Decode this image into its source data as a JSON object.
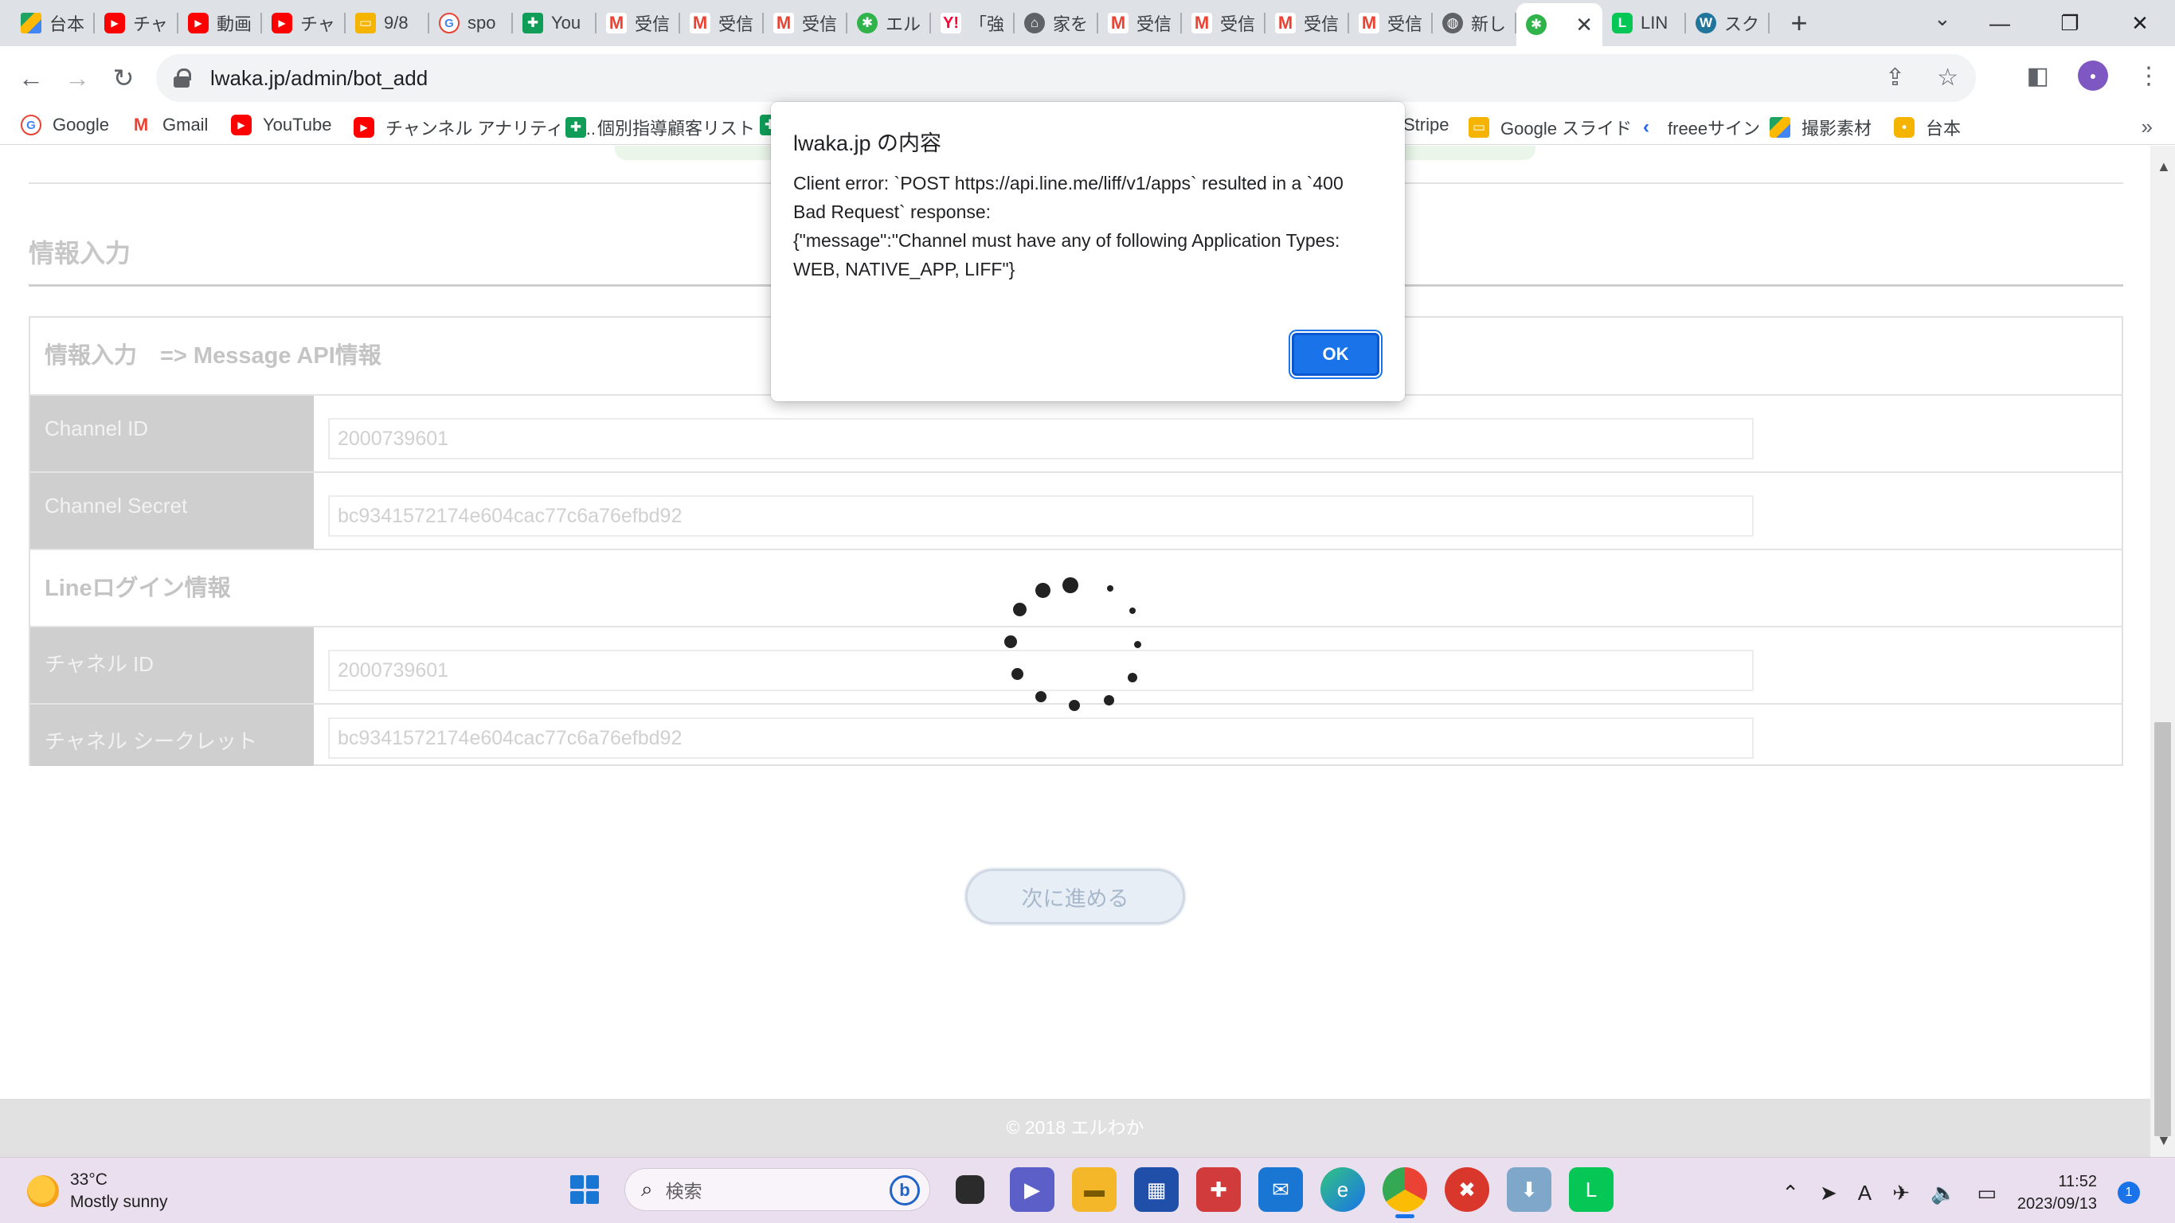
{
  "tabs": [
    {
      "label": "台本",
      "icon": "google-drive-icon"
    },
    {
      "label": "チャ",
      "icon": "youtube-icon"
    },
    {
      "label": "動画",
      "icon": "youtube-icon"
    },
    {
      "label": "チャ",
      "icon": "youtube-icon"
    },
    {
      "label": "9/8",
      "icon": "google-slides-icon"
    },
    {
      "label": "spo",
      "icon": "google-icon"
    },
    {
      "label": "You",
      "icon": "google-sheets-icon"
    },
    {
      "label": "受信",
      "icon": "gmail-icon"
    },
    {
      "label": "受信",
      "icon": "gmail-icon"
    },
    {
      "label": "受信",
      "icon": "gmail-icon"
    },
    {
      "label": "エル",
      "icon": "bug-icon"
    },
    {
      "label": "「強",
      "icon": "yahoo-icon"
    },
    {
      "label": "家を",
      "icon": "house-icon"
    },
    {
      "label": "受信",
      "icon": "gmail-icon"
    },
    {
      "label": "受信",
      "icon": "gmail-icon"
    },
    {
      "label": "受信",
      "icon": "gmail-icon"
    },
    {
      "label": "受信",
      "icon": "gmail-icon"
    },
    {
      "label": "新し",
      "icon": "globe-icon"
    },
    {
      "label": "",
      "icon": "bug-icon",
      "active": true
    },
    {
      "label": "LIN",
      "icon": "line-icon"
    },
    {
      "label": "スク",
      "icon": "wordpress-icon"
    }
  ],
  "address": {
    "url": "lwaka.jp/admin/bot_add"
  },
  "bookmarks": [
    {
      "label": "Google",
      "icon": "google-icon"
    },
    {
      "label": "Gmail",
      "icon": "gmail-icon"
    },
    {
      "label": "YouTube",
      "icon": "youtube-icon"
    },
    {
      "label": "チャンネル アナリティク...",
      "icon": "youtube-icon"
    },
    {
      "label": "個別指導顧客リスト",
      "icon": "google-sheets-icon"
    },
    {
      "label": "Stripe",
      "icon": "stripe-icon"
    },
    {
      "label": "Google スライド",
      "icon": "google-slides-icon"
    },
    {
      "label": "freeeサイン",
      "icon": "freee-icon"
    },
    {
      "label": "撮影素材",
      "icon": "google-drive-icon"
    },
    {
      "label": "台本",
      "icon": "google-keep-icon"
    }
  ],
  "page": {
    "section_title": "情報入力",
    "form_heading": "情報入力　=> Message API情報",
    "line_login_heading": "Lineログイン情報",
    "fields": [
      {
        "label": "Channel ID",
        "value": "2000739601"
      },
      {
        "label": "Channel Secret",
        "value": "bc9341572174e604cac77c6a76efbd92"
      },
      {
        "label": "チャネル ID",
        "value": "2000739601"
      },
      {
        "label": "チャネル シークレット",
        "value": "bc9341572174e604cac77c6a76efbd92"
      }
    ],
    "next_button": "次に進める",
    "footer": "© 2018 エルわか"
  },
  "dialog": {
    "title": "lwaka.jp の内容",
    "message": "Client error: `POST https://api.line.me/liff/v1/apps` resulted in a `400\nBad Request` response:\n{\"message\":\"Channel must have any of following Application Types:\nWEB, NATIVE_APP, LIFF\"}",
    "ok": "OK"
  },
  "taskbar": {
    "temperature": "33°C",
    "weather": "Mostly sunny",
    "search_placeholder": "検索",
    "time": "11:52",
    "date": "2023/09/13",
    "notifications": "1"
  }
}
